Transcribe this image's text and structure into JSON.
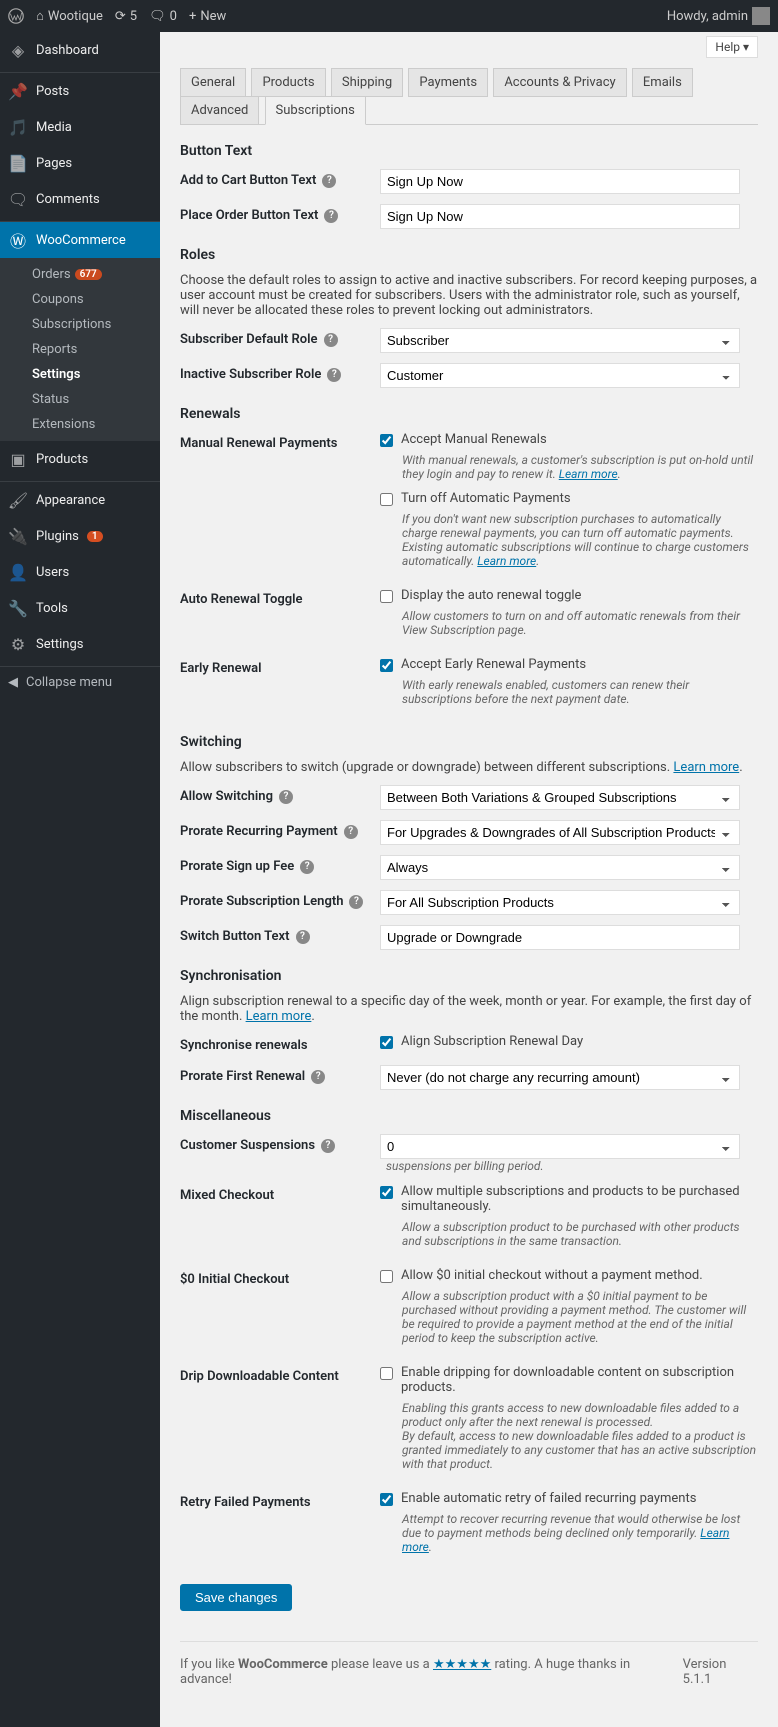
{
  "adminbar": {
    "site_name": "Wootique",
    "updates": "5",
    "comments": "0",
    "new": "New",
    "howdy": "Howdy, admin"
  },
  "sidebar": {
    "dashboard": "Dashboard",
    "posts": "Posts",
    "media": "Media",
    "pages": "Pages",
    "comments": "Comments",
    "woocommerce": "WooCommerce",
    "submenu": {
      "orders": "Orders",
      "orders_badge": "677",
      "coupons": "Coupons",
      "subscriptions": "Subscriptions",
      "reports": "Reports",
      "settings": "Settings",
      "status": "Status",
      "extensions": "Extensions"
    },
    "products": "Products",
    "appearance": "Appearance",
    "plugins": "Plugins",
    "plugins_badge": "1",
    "users": "Users",
    "tools": "Tools",
    "wpsettings": "Settings",
    "collapse": "Collapse menu"
  },
  "help": "Help",
  "tabs": {
    "general": "General",
    "products": "Products",
    "shipping": "Shipping",
    "payments": "Payments",
    "accounts": "Accounts & Privacy",
    "emails": "Emails",
    "advanced": "Advanced",
    "subscriptions": "Subscriptions"
  },
  "button_text": {
    "heading": "Button Text",
    "add_to_cart_label": "Add to Cart Button Text",
    "add_to_cart_value": "Sign Up Now",
    "place_order_label": "Place Order Button Text",
    "place_order_value": "Sign Up Now"
  },
  "roles": {
    "heading": "Roles",
    "desc": "Choose the default roles to assign to active and inactive subscribers. For record keeping purposes, a user account must be created for subscribers. Users with the administrator role, such as yourself, will never be allocated these roles to prevent locking out administrators.",
    "default_label": "Subscriber Default Role",
    "default_value": "Subscriber",
    "inactive_label": "Inactive Subscriber Role",
    "inactive_value": "Customer"
  },
  "renewals": {
    "heading": "Renewals",
    "manual_label": "Manual Renewal Payments",
    "accept_manual": "Accept Manual Renewals",
    "manual_desc_a": "With manual renewals, a customer's subscription is put on-hold until they login and pay to renew it. ",
    "learn_more": "Learn more",
    "turn_off_auto": "Turn off Automatic Payments",
    "turn_off_desc_a": "If you don't want new subscription purchases to automatically charge renewal payments, you can turn off automatic payments. Existing automatic subscriptions will continue to charge customers automatically. ",
    "auto_toggle_label": "Auto Renewal Toggle",
    "display_toggle": "Display the auto renewal toggle",
    "display_toggle_desc": "Allow customers to turn on and off automatic renewals from their View Subscription page.",
    "early_label": "Early Renewal",
    "accept_early": "Accept Early Renewal Payments",
    "early_desc": "With early renewals enabled, customers can renew their subscriptions before the next payment date."
  },
  "switching": {
    "heading": "Switching",
    "desc_a": "Allow subscribers to switch (upgrade or downgrade) between different subscriptions. ",
    "learn_more": "Learn more",
    "allow_label": "Allow Switching",
    "allow_value": "Between Both Variations & Grouped Subscriptions",
    "prorate_recurring_label": "Prorate Recurring Payment",
    "prorate_recurring_value": "For Upgrades & Downgrades of All Subscription Products",
    "prorate_signup_label": "Prorate Sign up Fee",
    "prorate_signup_value": "Always",
    "prorate_length_label": "Prorate Subscription Length",
    "prorate_length_value": "For All Subscription Products",
    "switch_btn_label": "Switch Button Text",
    "switch_btn_value": "Upgrade or Downgrade"
  },
  "sync": {
    "heading": "Synchronisation",
    "desc_a": "Align subscription renewal to a specific day of the week, month or year. For example, the first day of the month. ",
    "learn_more": "Learn more",
    "sync_label": "Synchronise renewals",
    "align": "Align Subscription Renewal Day",
    "prorate_first_label": "Prorate First Renewal",
    "prorate_first_value": "Never (do not charge any recurring amount)"
  },
  "misc": {
    "heading": "Miscellaneous",
    "susp_label": "Customer Suspensions",
    "susp_value": "0",
    "susp_suffix": "suspensions per billing period.",
    "mixed_label": "Mixed Checkout",
    "mixed_chk": "Allow multiple subscriptions and products to be purchased simultaneously.",
    "mixed_desc": "Allow a subscription product to be purchased with other products and subscriptions in the same transaction.",
    "zero_label": "$0 Initial Checkout",
    "zero_chk": "Allow $0 initial checkout without a payment method.",
    "zero_desc": "Allow a subscription product with a $0 initial payment to be purchased without providing a payment method. The customer will be required to provide a payment method at the end of the initial period to keep the subscription active.",
    "drip_label": "Drip Downloadable Content",
    "drip_chk": "Enable dripping for downloadable content on subscription products.",
    "drip_desc1": "Enabling this grants access to new downloadable files added to a product only after the next renewal is processed.",
    "drip_desc2": "By default, access to new downloadable files added to a product is granted immediately to any customer that has an active subscription with that product.",
    "retry_label": "Retry Failed Payments",
    "retry_chk": "Enable automatic retry of failed recurring payments",
    "retry_desc_a": "Attempt to recover recurring revenue that would otherwise be lost due to payment methods being declined only temporarily. ",
    "learn_more": "Learn more"
  },
  "save": "Save changes",
  "footer": {
    "credit_a": "If you like ",
    "credit_b": "WooCommerce",
    "credit_c": " please leave us a ",
    "stars": "★★★★★",
    "credit_d": " rating. A huge thanks in advance!",
    "version": "Version 5.1.1"
  }
}
